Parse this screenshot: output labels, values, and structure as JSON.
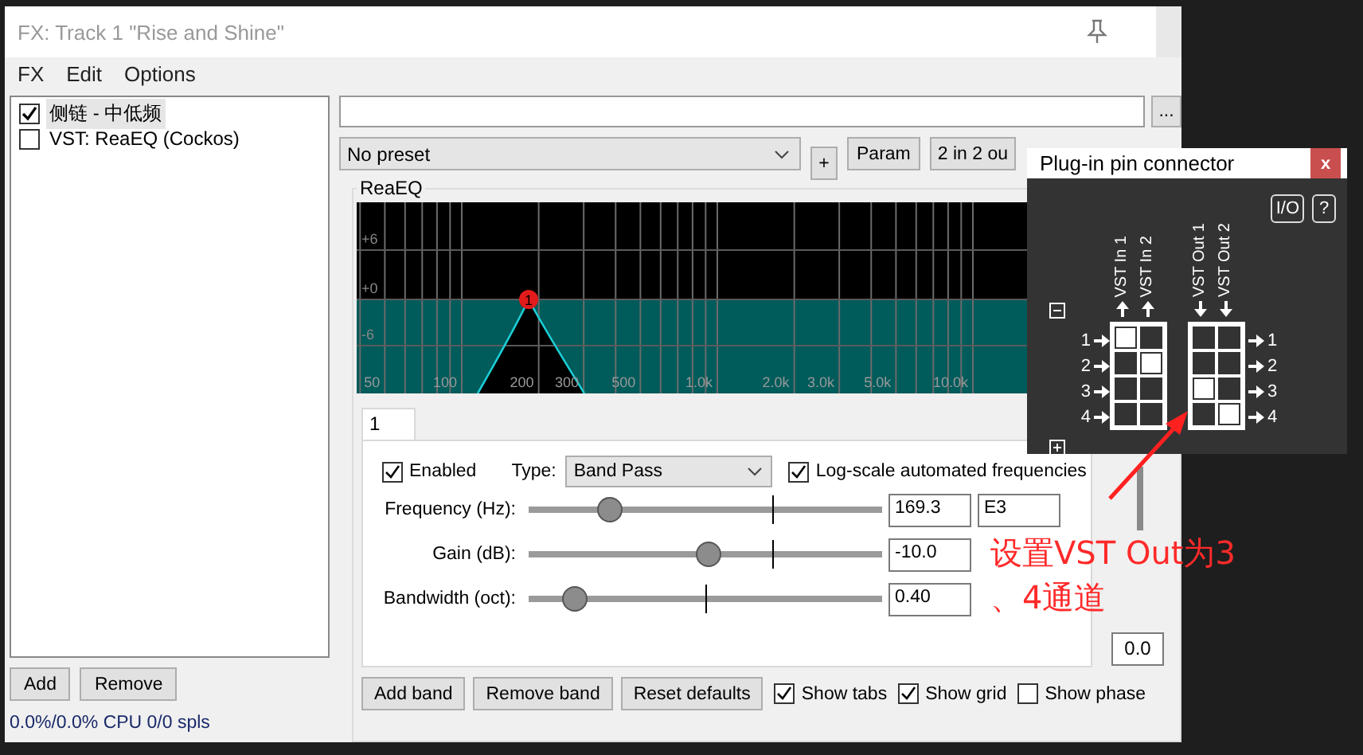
{
  "window": {
    "title": "FX: Track 1 \"Rise and Shine\""
  },
  "menu": [
    "FX",
    "Edit",
    "Options"
  ],
  "fx_list": [
    {
      "label": "侧链 - 中低频",
      "checked": true,
      "selected": true
    },
    {
      "label": "VST: ReaEQ (Cockos)",
      "checked": false,
      "selected": false
    }
  ],
  "fx_buttons": [
    "Add",
    "Remove"
  ],
  "status": "0.0%/0.0% CPU 0/0 spls",
  "toolbar": {
    "browse": "...",
    "preset": "No preset",
    "buttons": [
      "+",
      "Param",
      "2 in 2 ou"
    ]
  },
  "plugin": {
    "name": "ReaEQ",
    "graph": {
      "db_labels": [
        "+6",
        "+0",
        "-6"
      ],
      "freq_labels": [
        "50",
        "100",
        "200",
        "300",
        "500",
        "1.0k",
        "2.0k",
        "3.0k",
        "5.0k",
        "10.0k"
      ],
      "band_marker": "1"
    },
    "tabs": [
      {
        "label": "1",
        "selected": true
      }
    ],
    "enabled": {
      "label": "Enabled",
      "checked": true
    },
    "type": {
      "label": "Type:",
      "value": "Band Pass"
    },
    "log_scale": {
      "label": "Log-scale automated frequencies",
      "checked": true
    },
    "params": [
      {
        "label": "Frequency (Hz):",
        "level": 0.23,
        "value": "169.3",
        "note": "E3"
      },
      {
        "label": "Gain (dB):",
        "level": 0.51,
        "value": "-10.0"
      },
      {
        "label": "Bandwidth (oct):",
        "level": 0.13,
        "value": "0.40"
      }
    ],
    "buttons": [
      "Add band",
      "Remove band",
      "Reset defaults"
    ],
    "options": [
      {
        "label": "Show tabs",
        "checked": true
      },
      {
        "label": "Show grid",
        "checked": true
      },
      {
        "label": "Show phase",
        "checked": false
      }
    ],
    "output_value": "0.0"
  },
  "pin_connector": {
    "title": "Plug-in pin connector",
    "close": "x",
    "buttons": [
      "I/O",
      "?"
    ],
    "inputs": {
      "labels": [
        "VST In 1",
        "VST In 2"
      ],
      "pins": [
        {
          "label": "1",
          "cells": [
            {
              "on": true
            },
            {
              "on": false
            }
          ]
        },
        {
          "label": "2",
          "cells": [
            {
              "on": false
            },
            {
              "on": true
            }
          ]
        },
        {
          "label": "3",
          "cells": [
            {
              "on": false
            },
            {
              "on": false
            }
          ]
        },
        {
          "label": "4",
          "cells": [
            {
              "on": false
            },
            {
              "on": false
            }
          ]
        }
      ]
    },
    "outputs": {
      "labels": [
        "VST Out 1",
        "VST Out 2"
      ],
      "pins": [
        {
          "label": "1",
          "cells": [
            {
              "on": false
            },
            {
              "on": false
            }
          ]
        },
        {
          "label": "2",
          "cells": [
            {
              "on": false
            },
            {
              "on": false
            }
          ]
        },
        {
          "label": "3",
          "cells": [
            {
              "on": true
            },
            {
              "on": false
            }
          ]
        },
        {
          "label": "4",
          "cells": [
            {
              "on": false
            },
            {
              "on": true
            }
          ]
        }
      ]
    }
  },
  "annotation": {
    "text": "设置VST Out为3\n、4通道"
  }
}
